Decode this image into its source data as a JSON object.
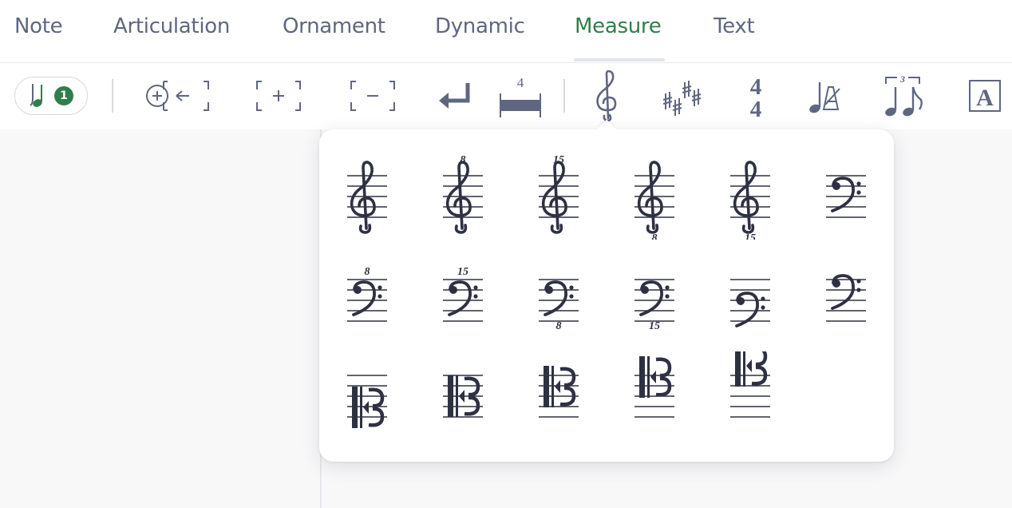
{
  "tabs": [
    {
      "label": "Note",
      "active": false
    },
    {
      "label": "Articulation",
      "active": false
    },
    {
      "label": "Ornament",
      "active": false
    },
    {
      "label": "Dynamic",
      "active": false
    },
    {
      "label": "Measure",
      "active": true
    },
    {
      "label": "Text",
      "active": false
    }
  ],
  "toolbar": {
    "note_count": "1",
    "measure_number": "4",
    "time_signature_top": "4",
    "time_signature_bottom": "4",
    "tuplet_number": "3",
    "text_box_label": "A"
  },
  "clef_menu": {
    "rows": [
      [
        {
          "type": "treble",
          "mark": ""
        },
        {
          "type": "treble",
          "mark": "8",
          "position": "above"
        },
        {
          "type": "treble",
          "mark": "15",
          "position": "above"
        },
        {
          "type": "treble",
          "mark": "8",
          "position": "below"
        },
        {
          "type": "treble",
          "mark": "15",
          "position": "below"
        },
        {
          "type": "bass",
          "mark": ""
        }
      ],
      [
        {
          "type": "bass",
          "mark": "8",
          "position": "above"
        },
        {
          "type": "bass",
          "mark": "15",
          "position": "above"
        },
        {
          "type": "bass",
          "mark": "8",
          "position": "below"
        },
        {
          "type": "bass",
          "mark": "15",
          "position": "below"
        },
        {
          "type": "bass-low",
          "mark": ""
        },
        {
          "type": "bass-high",
          "mark": ""
        }
      ],
      [
        {
          "type": "c-clef",
          "mark": "",
          "line": 1
        },
        {
          "type": "c-clef",
          "mark": "",
          "line": 2
        },
        {
          "type": "c-clef",
          "mark": "",
          "line": 3
        },
        {
          "type": "c-clef",
          "mark": "",
          "line": 4
        },
        {
          "type": "c-clef",
          "mark": "",
          "line": 5
        }
      ]
    ]
  },
  "colors": {
    "accent": "#2f7f4a",
    "icon": "#5f6780",
    "glyph": "#2e3142"
  }
}
